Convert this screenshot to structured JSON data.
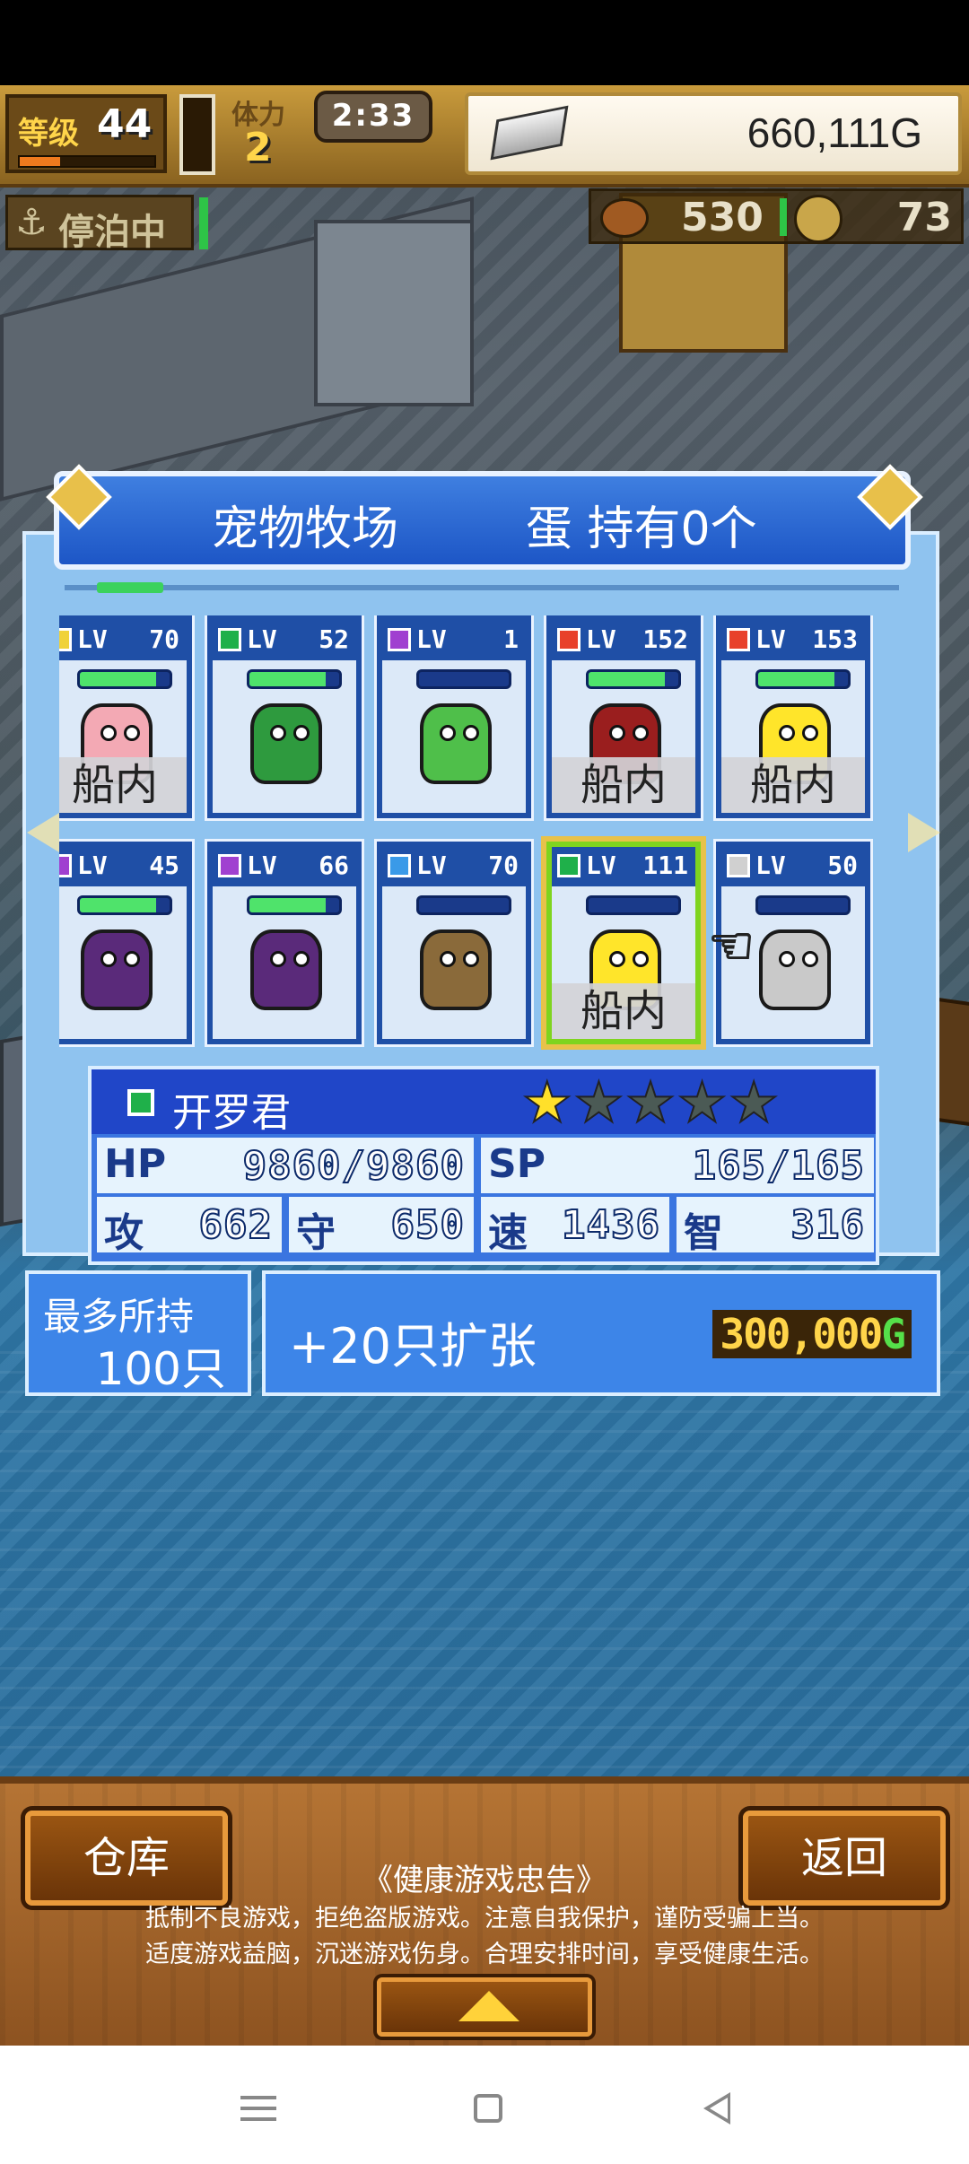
{
  "hud": {
    "level_label": "等级",
    "level_value": "44",
    "level_progress": 0.3,
    "stamina_label": "体力",
    "stamina_value": "2",
    "timer": "2:33",
    "gold": "660,111G"
  },
  "status": {
    "anchor_label": "停泊中",
    "meat": "530",
    "coins": "73"
  },
  "ranch": {
    "title": "宠物牧场",
    "eggs": "蛋 持有0个",
    "scroll_progress": 0.08,
    "onboard_label": "船内",
    "pets": [
      {
        "lv": "70",
        "elem_color": "#f0d23a",
        "hp": 0.85,
        "onboard": true,
        "color": "#f3a9b4",
        "row": 0
      },
      {
        "lv": "52",
        "elem_color": "#1fb04a",
        "hp": 0.85,
        "onboard": false,
        "color": "#2e9a3e",
        "row": 0
      },
      {
        "lv": "1",
        "elem_color": "#a040d0",
        "hp": 0.0,
        "onboard": false,
        "color": "#4fbf4a",
        "row": 0
      },
      {
        "lv": "152",
        "elem_color": "#e8402a",
        "hp": 0.85,
        "onboard": true,
        "color": "#9a1e1e",
        "row": 0
      },
      {
        "lv": "153",
        "elem_color": "#e8402a",
        "hp": 0.85,
        "onboard": true,
        "color": "#ffe52a",
        "row": 0
      },
      {
        "lv": "45",
        "elem_color": "#a040d0",
        "hp": 0.85,
        "onboard": false,
        "color": "#5a2a7a",
        "row": 1
      },
      {
        "lv": "66",
        "elem_color": "#a040d0",
        "hp": 0.85,
        "onboard": false,
        "color": "#5a2a7a",
        "row": 1
      },
      {
        "lv": "70",
        "elem_color": "#3a9ae8",
        "hp": 0.0,
        "onboard": false,
        "color": "#8a6a3a",
        "row": 1
      },
      {
        "lv": "111",
        "elem_color": "#1fb04a",
        "hp": 0.0,
        "onboard": true,
        "color": "#ffe52a",
        "row": 1,
        "selected": true
      },
      {
        "lv": "50",
        "elem_color": "#d0d0d0",
        "hp": 0.0,
        "onboard": false,
        "color": "#c9c9c9",
        "row": 1
      }
    ]
  },
  "detail": {
    "name": "开罗君",
    "stars_total": 5,
    "stars_filled": 1,
    "hp_label": "HP",
    "hp_value": "9860/9860",
    "sp_label": "SP",
    "sp_value": "165/165",
    "atk_label": "攻",
    "atk_value": "662",
    "def_label": "守",
    "def_value": "650",
    "spd_label": "速",
    "spd_value": "1436",
    "int_label": "智",
    "int_value": "316"
  },
  "capacity": {
    "label": "最多所持",
    "value": "100只"
  },
  "expand": {
    "label": "+20只扩张",
    "cost": "300,000",
    "cost_unit": "G"
  },
  "bottom": {
    "warehouse": "仓库",
    "back": "返回",
    "health_title": "《健康游戏忠告》",
    "health_line1": "抵制不良游戏，拒绝盗版游戏。注意自我保护，谨防受骗上当。",
    "health_line2": "适度游戏益脑，沉迷游戏伤身。合理安排时间，享受健康生活。"
  }
}
